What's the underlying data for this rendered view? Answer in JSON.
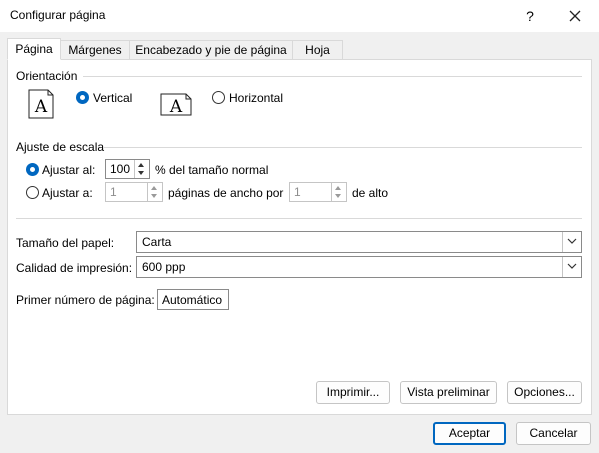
{
  "window": {
    "title": "Configurar página",
    "help_label": "?"
  },
  "tabs": [
    {
      "label": "Página",
      "active": true
    },
    {
      "label": "Márgenes",
      "active": false
    },
    {
      "label": "Encabezado y pie de página",
      "active": false
    },
    {
      "label": "Hoja",
      "active": false
    }
  ],
  "orientation": {
    "section_label": "Orientación",
    "vertical_label": "Vertical",
    "horizontal_label": "Horizontal",
    "selected": "vertical"
  },
  "scaling": {
    "section_label": "Ajuste de escala",
    "adjust_to_label": "Ajustar al:",
    "adjust_to_value": "100",
    "adjust_to_suffix": "% del tamaño normal",
    "fit_to_label": "Ajustar a:",
    "fit_wide_value": "1",
    "fit_wide_suffix": "páginas de ancho por",
    "fit_tall_value": "1",
    "fit_tall_suffix": "de alto",
    "selected": "adjust_to"
  },
  "paper": {
    "size_label": "Tamaño del papel:",
    "size_value": "Carta",
    "quality_label": "Calidad de impresión:",
    "quality_value": "600 ppp",
    "first_page_label": "Primer número de página:",
    "first_page_value": "Automático"
  },
  "buttons": {
    "print": "Imprimir...",
    "preview": "Vista preliminar",
    "options": "Opciones...",
    "ok": "Aceptar",
    "cancel": "Cancelar"
  },
  "colors": {
    "accent": "#0067c0",
    "background": "#f0f0f0"
  }
}
